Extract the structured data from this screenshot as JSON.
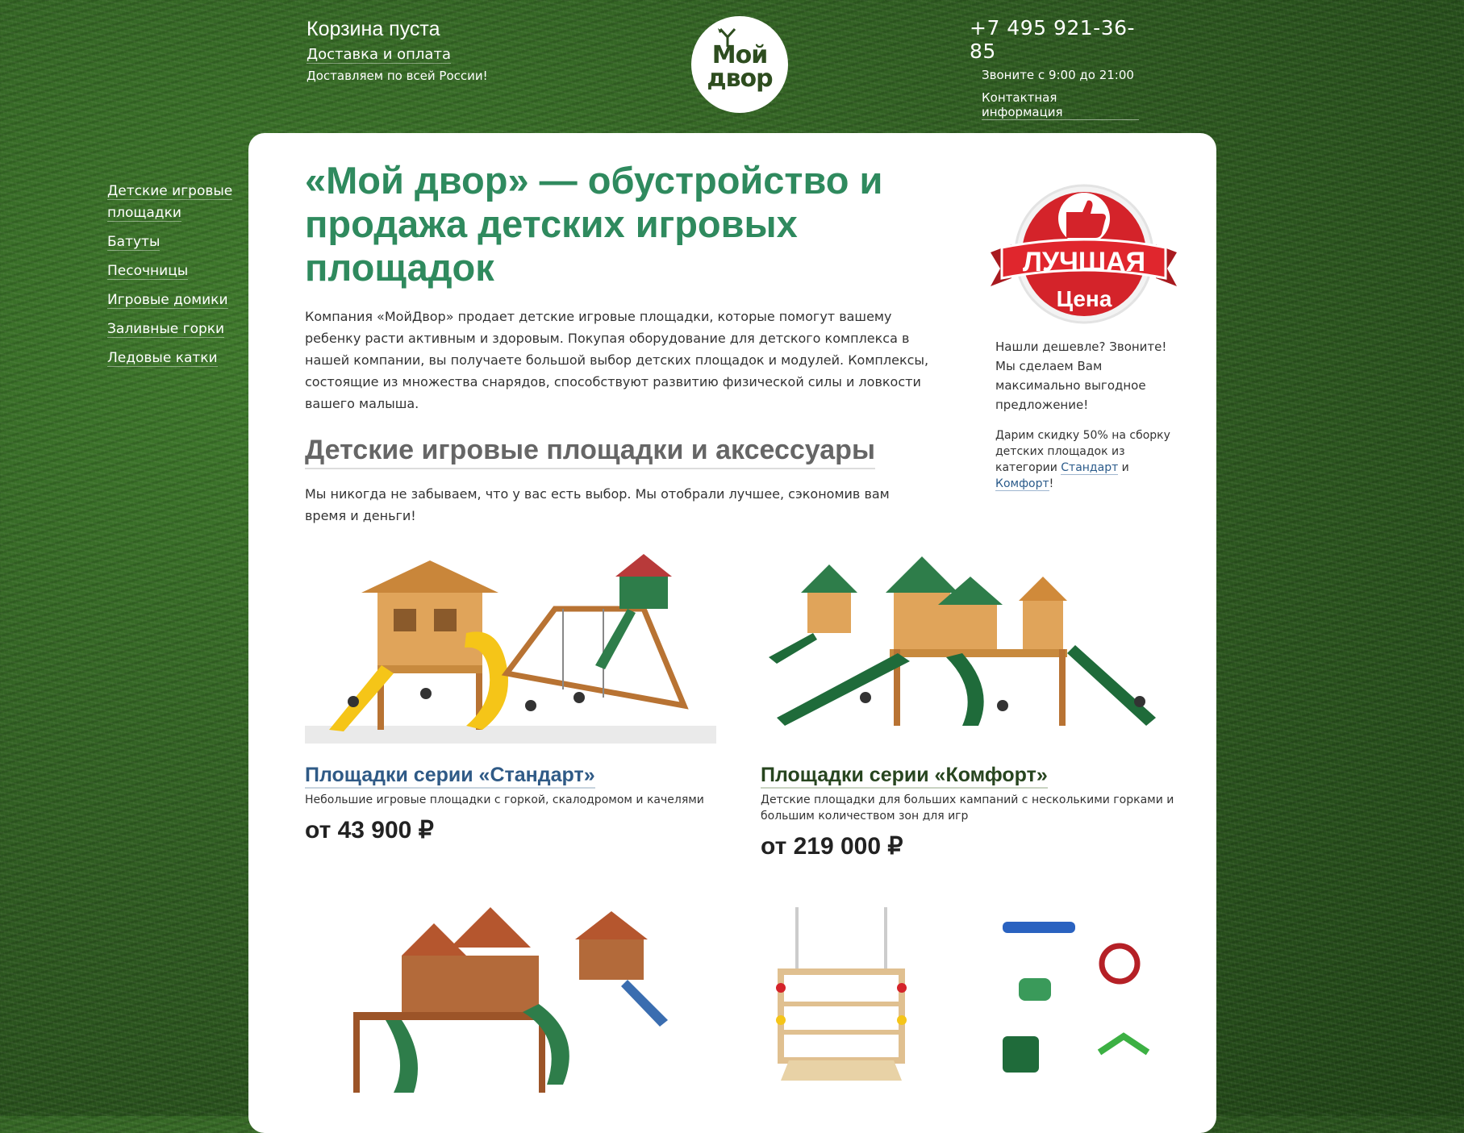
{
  "header": {
    "cart": "Корзина пуста",
    "delivery": "Доставка и оплата",
    "delivery_note": "Доставляем по всей России!",
    "logo_line1": "Мой",
    "logo_line2": "двор",
    "phone": "+7 495 921-36-85",
    "hours": "Звоните с 9:00 до 21:00",
    "contacts": "Контактная информация"
  },
  "sidebar": {
    "items": [
      {
        "label": "Детские игровые площадки"
      },
      {
        "label": "Батуты"
      },
      {
        "label": "Песочницы"
      },
      {
        "label": "Игровые домики"
      },
      {
        "label": "Заливные горки"
      },
      {
        "label": "Ледовые катки"
      }
    ]
  },
  "main": {
    "title": "«Мой двор» — обустройство и продажа детских игровых площадок",
    "intro": "Компания «МойДвор» продает детские игровые площадки, которые помогут вашему ребенку расти активным и здоровым. Покупая оборудование для детского комплекса в нашей компании, вы получаете большой выбор детских площадок и модулей. Комплексы, состоящие из множества снарядов, способствуют развитию физической силы и ловкости вашего малыша.",
    "section_title": "Детские игровые площадки и аксессуары",
    "section_intro": "Мы никогда не забываем, что у вас есть выбор. Мы отобрали лучшее, сэкономив вам время и деньги!"
  },
  "promo": {
    "badge_line1": "ЛУЧШАЯ",
    "badge_line2": "Цена",
    "text1": "Нашли дешевле? Звоните! Мы сделаем Вам максимально выгодное предложение!",
    "text2_pre": "Дарим скидку 50% на сборку детских площадок из категории ",
    "link1": "Стандарт",
    "and": " и ",
    "link2": "Комфорт",
    "end": "!"
  },
  "products": [
    {
      "name": "Площадки серии «Стандарт»",
      "desc": "Небольшие игровые площадки с горкой, скалодромом и качелями",
      "price": "от 43 900 ₽"
    },
    {
      "name": "Площадки серии «Комфорт»",
      "desc": "Детские площадки для больших кампаний с несколькими горками и большим количеством зон для игр",
      "price": "от 219 000 ₽"
    }
  ],
  "colors": {
    "title": "#2f8a5e",
    "link_blue": "#2f5a86",
    "link_green": "#27451f",
    "badge_red": "#d4232a"
  }
}
